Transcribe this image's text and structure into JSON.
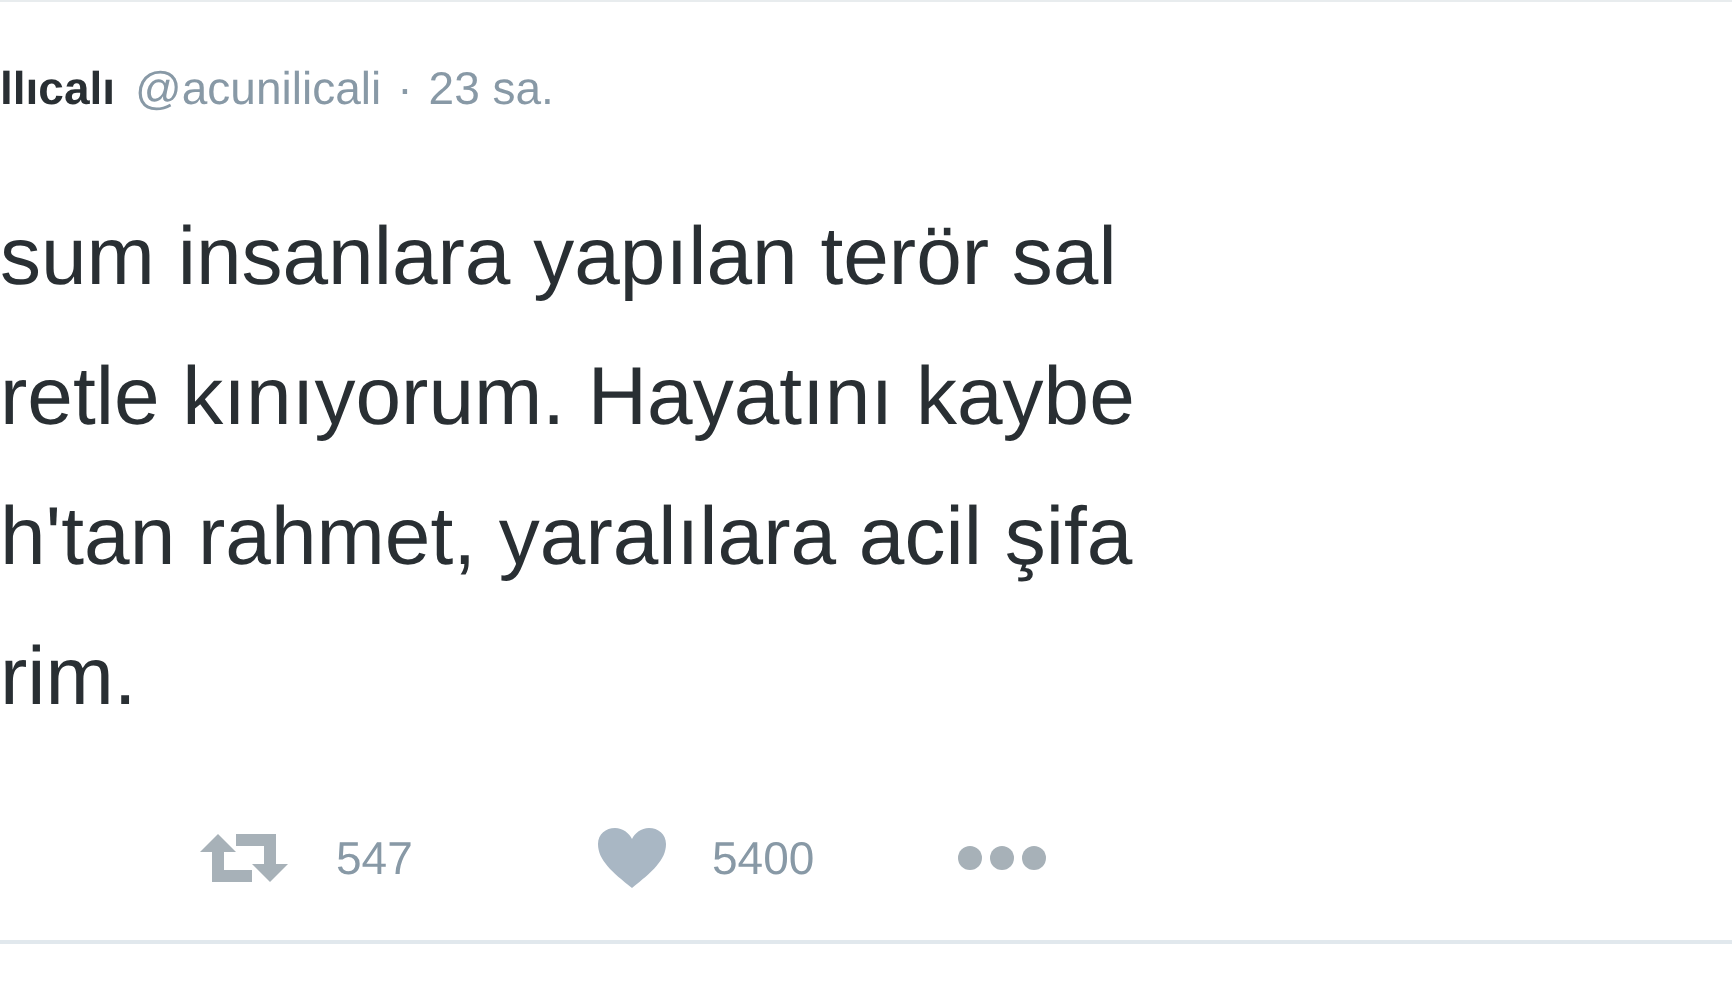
{
  "tweet": {
    "author_name": "llıcalı",
    "handle": "@acunilicali",
    "separator": "·",
    "time": "23 sa.",
    "text_lines": [
      "sum insanlara yapılan terör sal",
      "retle kınıyorum. Hayatını kaybe",
      "h'tan rahmet, yaralılara acil şifa",
      "rim."
    ],
    "actions": [
      {
        "kind": "retweet",
        "count": "547"
      },
      {
        "kind": "like",
        "count": "5400"
      },
      {
        "kind": "more"
      }
    ]
  }
}
